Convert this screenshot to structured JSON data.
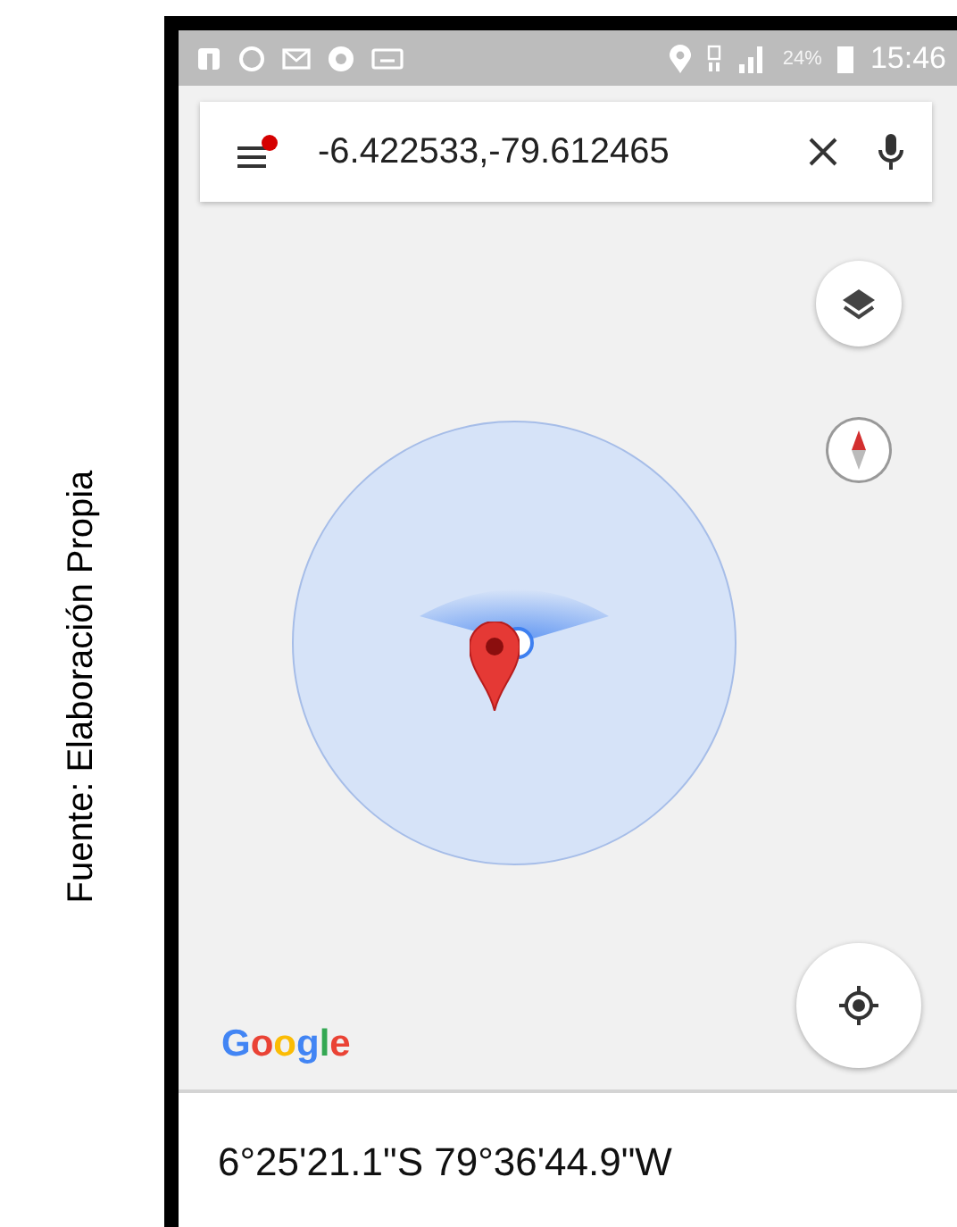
{
  "caption": "Fuente: Elaboración Propia",
  "status_bar": {
    "battery": "24%",
    "time": "15:46"
  },
  "search": {
    "value": "-6.422533,-79.612465",
    "menu_badge": true
  },
  "map": {
    "logo": "Google"
  },
  "coordinates": "6°25'21.1\"S 79°36'44.9\"W"
}
